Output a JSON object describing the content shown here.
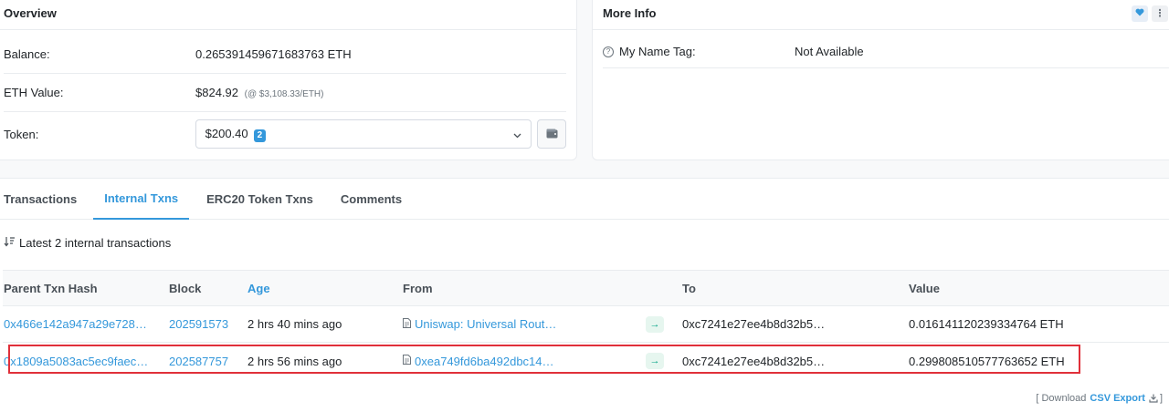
{
  "overview": {
    "title": "Overview",
    "balance_label": "Balance:",
    "balance_value": "0.265391459671683763 ETH",
    "eth_value_label": "ETH Value:",
    "eth_value": "$824.92",
    "eth_price_note": "(@ $3,108.33/ETH)",
    "token_label": "Token:",
    "token_value": "$200.40",
    "token_count": "2",
    "wallet_icon": "wallet-icon"
  },
  "more_info": {
    "title": "More Info",
    "name_tag_label": "My Name Tag:",
    "name_tag_value": "Not Available",
    "heart_icon": "heart-icon",
    "menu_icon": "vertical-dots-icon"
  },
  "tabs": [
    {
      "label": "Transactions",
      "active": false
    },
    {
      "label": "Internal Txns",
      "active": true
    },
    {
      "label": "ERC20 Token Txns",
      "active": false
    },
    {
      "label": "Comments",
      "active": false
    }
  ],
  "summary": "Latest 2 internal transactions",
  "table": {
    "columns": [
      "Parent Txn Hash",
      "Block",
      "Age",
      "From",
      "",
      "To",
      "Value"
    ],
    "rows": [
      {
        "hash": "0x466e142a947a29e728…",
        "block": "202591573",
        "age": "2 hrs 40 mins ago",
        "from": "Uniswap: Universal Rout…",
        "direction": "→",
        "to": "0xc7241e27ee4b8d32b5…",
        "value": "0.016141120239334764 ETH"
      },
      {
        "hash": "0x1809a5083ac5ec9faec…",
        "block": "202587757",
        "age": "2 hrs 56 mins ago",
        "from": "0xea749fd6ba492dbc14…",
        "direction": "→",
        "to": "0xc7241e27ee4b8d32b5…",
        "value": "0.299808510577763652 ETH"
      }
    ]
  },
  "download": {
    "prefix": "[ Download",
    "link": "CSV Export",
    "suffix": "]"
  },
  "colors": {
    "accent": "#3498db",
    "highlight_border": "#e0303a",
    "arrow_badge_bg": "#e6f6ef",
    "arrow_badge_fg": "#00a186"
  }
}
